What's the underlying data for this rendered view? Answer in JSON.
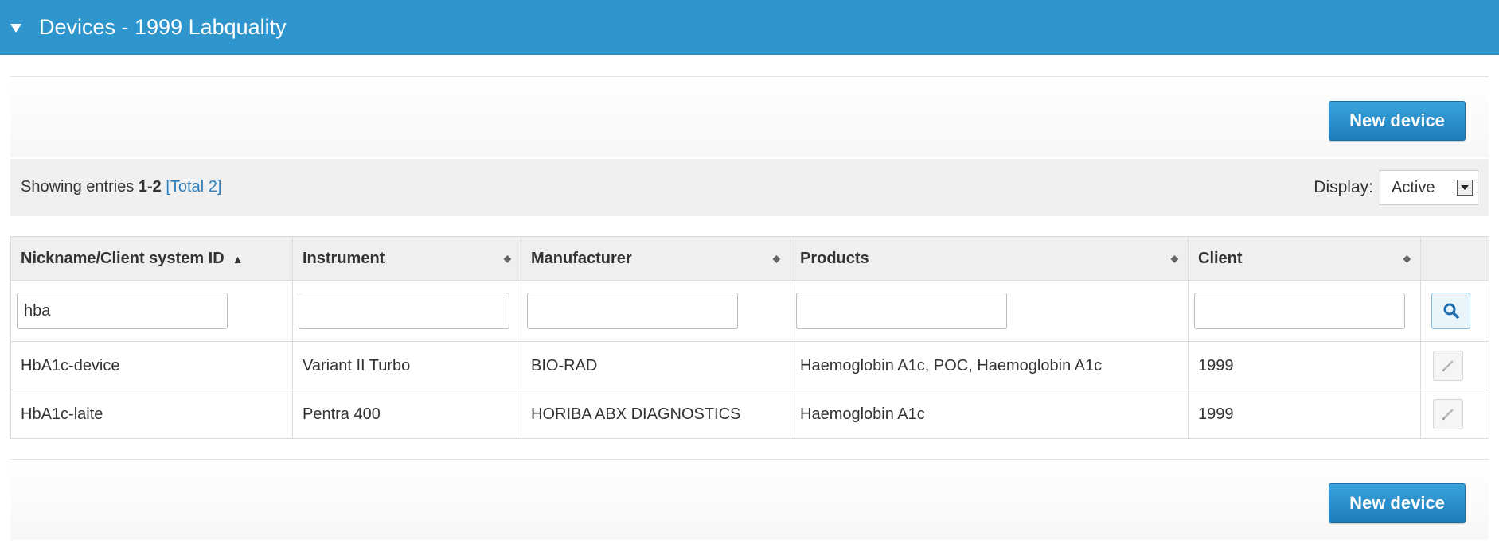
{
  "panel": {
    "title": "Devices - 1999 Labquality"
  },
  "toolbar": {
    "new_device_label": "New device"
  },
  "info": {
    "prefix": "Showing entries ",
    "range": "1-2",
    "total_open": "[",
    "total_label": "Total 2",
    "total_close": "]",
    "display_label": "Display:",
    "display_value": "Active"
  },
  "table": {
    "columns": [
      {
        "label": "Nickname/Client system ID",
        "sort": "asc"
      },
      {
        "label": "Instrument",
        "sort": "none"
      },
      {
        "label": "Manufacturer",
        "sort": "none"
      },
      {
        "label": "Products",
        "sort": "none"
      },
      {
        "label": "Client",
        "sort": "none"
      }
    ],
    "filters": [
      "hba",
      "",
      "",
      "",
      ""
    ],
    "rows": [
      [
        "HbA1c-device",
        "Variant II Turbo",
        "BIO-RAD",
        "Haemoglobin A1c, POC, Haemoglobin A1c",
        "1999"
      ],
      [
        "HbA1c-laite",
        "Pentra 400",
        "HORIBA ABX DIAGNOSTICS",
        "Haemoglobin A1c",
        "1999"
      ]
    ]
  },
  "icons": {
    "collapse": "triangle-down-icon",
    "search": "magnifier-icon",
    "edit": "pencil-icon",
    "sort_asc": "arrow-up-icon",
    "sort_both": "sort-both-icon",
    "dropdown": "chevron-down-icon"
  },
  "colors": {
    "header_bg": "#2e95cd",
    "button_bg": "#2485c4",
    "link": "#2e7fbd"
  }
}
